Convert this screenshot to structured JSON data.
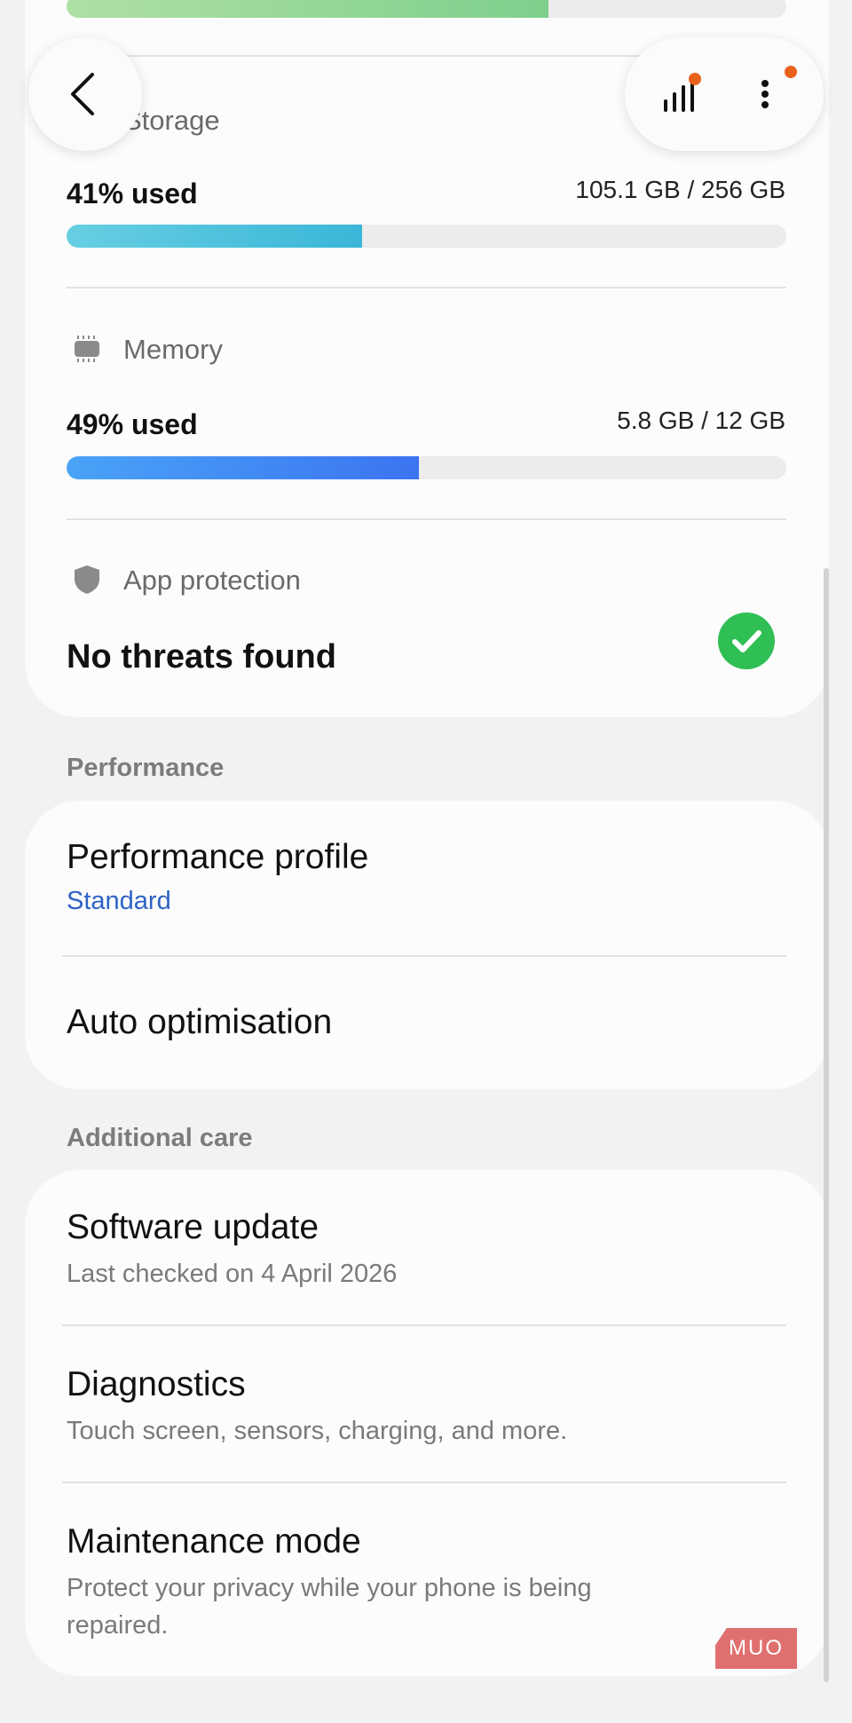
{
  "top_card": {
    "previous_bar_progress": 0.67,
    "storage": {
      "label": "Storage",
      "used": "41% used",
      "amount": "105.1 GB / 256 GB",
      "progress": 0.41
    },
    "memory": {
      "label": "Memory",
      "used": "49% used",
      "amount": "5.8 GB / 12 GB",
      "progress": 0.49
    },
    "app_protection": {
      "label": "App protection",
      "status": "No threats found"
    }
  },
  "performance": {
    "title": "Performance",
    "items": [
      {
        "title": "Performance profile",
        "subtitle": "Standard"
      },
      {
        "title": "Auto optimisation"
      }
    ]
  },
  "additional_care": {
    "title": "Additional care",
    "items": [
      {
        "title": "Software update",
        "subtitle": "Last checked on 4 April 2026"
      },
      {
        "title": "Diagnostics",
        "subtitle": "Touch screen, sensors, charging, and more."
      },
      {
        "title": "Maintenance mode",
        "subtitle": "Protect your privacy while your phone is being repaired."
      }
    ]
  },
  "toolbar": {
    "back_icon": "chevron-left-icon",
    "stats_icon": "bar-chart-icon",
    "more_icon": "more-vertical-icon"
  },
  "watermark": "MUO",
  "colors": {
    "storage_bar": "#3ab6d8",
    "memory_bar": "#3b74f1",
    "check_green": "#2fbf55",
    "accent_blue": "#2f63c4",
    "notification_dot": "#e8621c"
  }
}
